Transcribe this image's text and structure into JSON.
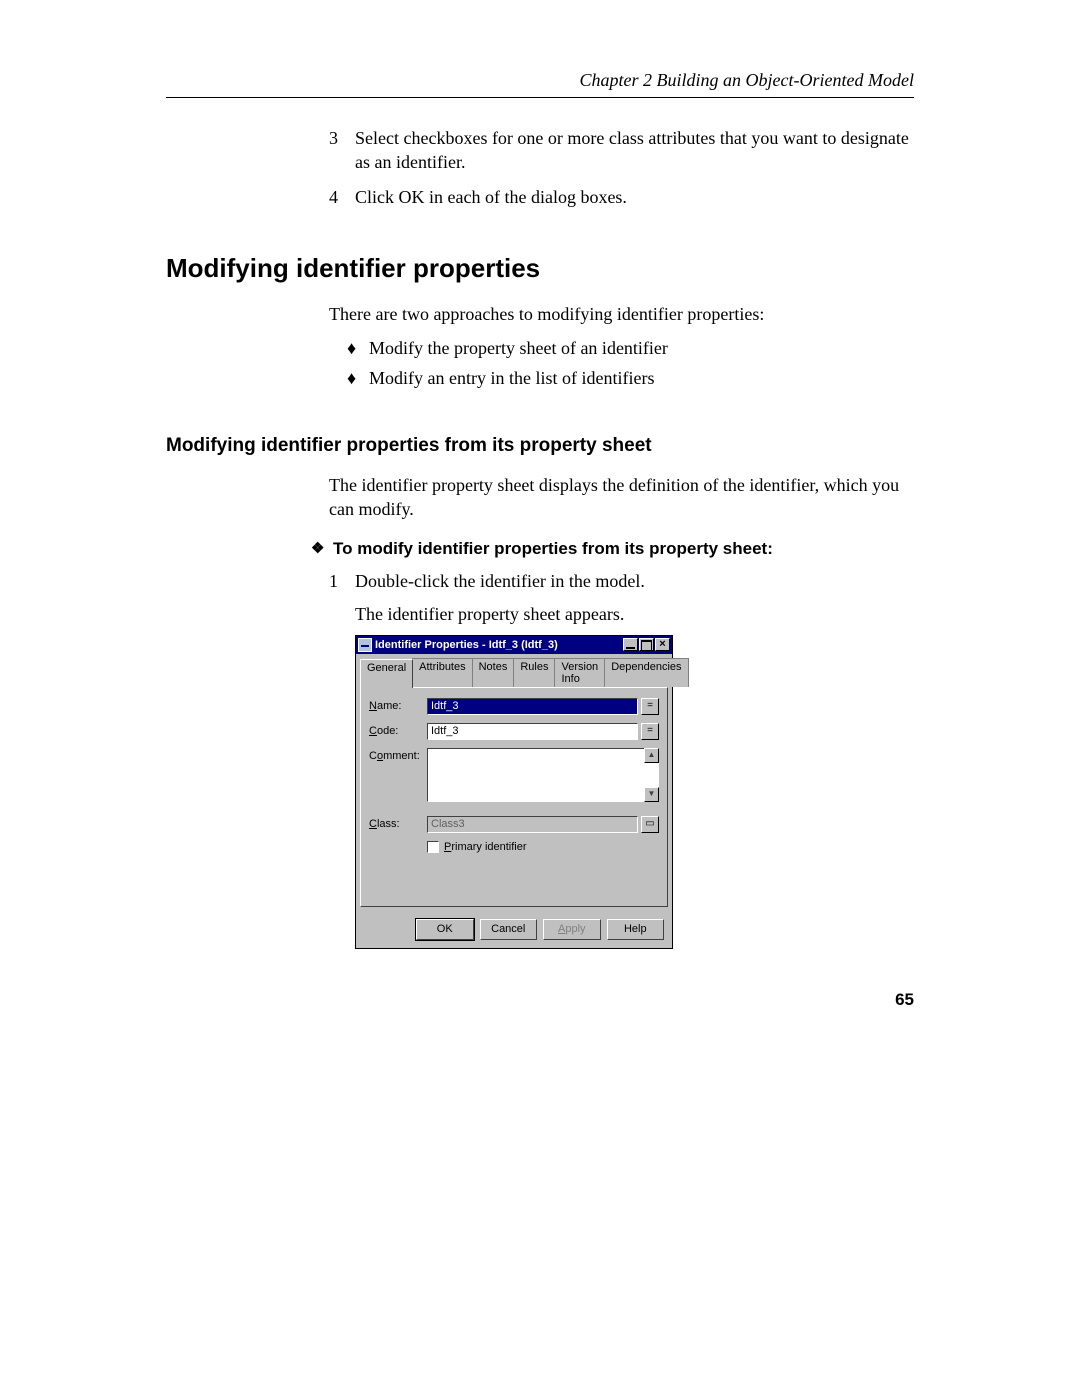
{
  "header": {
    "running_head": "Chapter 2  Building an Object-Oriented Model"
  },
  "steps_cont": [
    {
      "num": "3",
      "text": "Select checkboxes for one or more class attributes that you want to designate as an identifier."
    },
    {
      "num": "4",
      "text": "Click OK in each of the dialog boxes."
    }
  ],
  "section": {
    "h1": "Modifying identifier properties",
    "intro": "There are two approaches to modifying identifier properties:",
    "bullets": [
      "Modify the property sheet of an identifier",
      "Modify an entry in the list of identifiers"
    ],
    "h2": "Modifying identifier properties from its property sheet",
    "para2": "The identifier property sheet displays the definition of the identifier, which you can modify.",
    "proc_title": "To modify identifier properties from its property sheet:",
    "proc_steps": [
      {
        "num": "1",
        "text": "Double-click the identifier in the model."
      }
    ],
    "proc_result": "The identifier property sheet appears."
  },
  "dialog": {
    "title": "Identifier Properties - Idtf_3 (Idtf_3)",
    "tabs": [
      "General",
      "Attributes",
      "Notes",
      "Rules",
      "Version Info",
      "Dependencies"
    ],
    "active_tab": "General",
    "fields": {
      "name_label_u": "N",
      "name_label_rest": "ame:",
      "name_value": "Idtf_3",
      "code_label_u": "C",
      "code_label_rest": "ode:",
      "code_value": "Idtf_3",
      "comment_label_pre": "C",
      "comment_label_u": "o",
      "comment_label_rest": "mment:",
      "class_label_u": "C",
      "class_label_rest": "lass:",
      "class_value": "Class3",
      "primary_label_u": "P",
      "primary_label_rest": "rimary identifier"
    },
    "buttons": {
      "ok": "OK",
      "cancel": "Cancel",
      "apply": "Apply",
      "help": "Help"
    },
    "sidebtns": {
      "eq": "=",
      "link": "=",
      "props": "▭"
    }
  },
  "page_number": "65"
}
